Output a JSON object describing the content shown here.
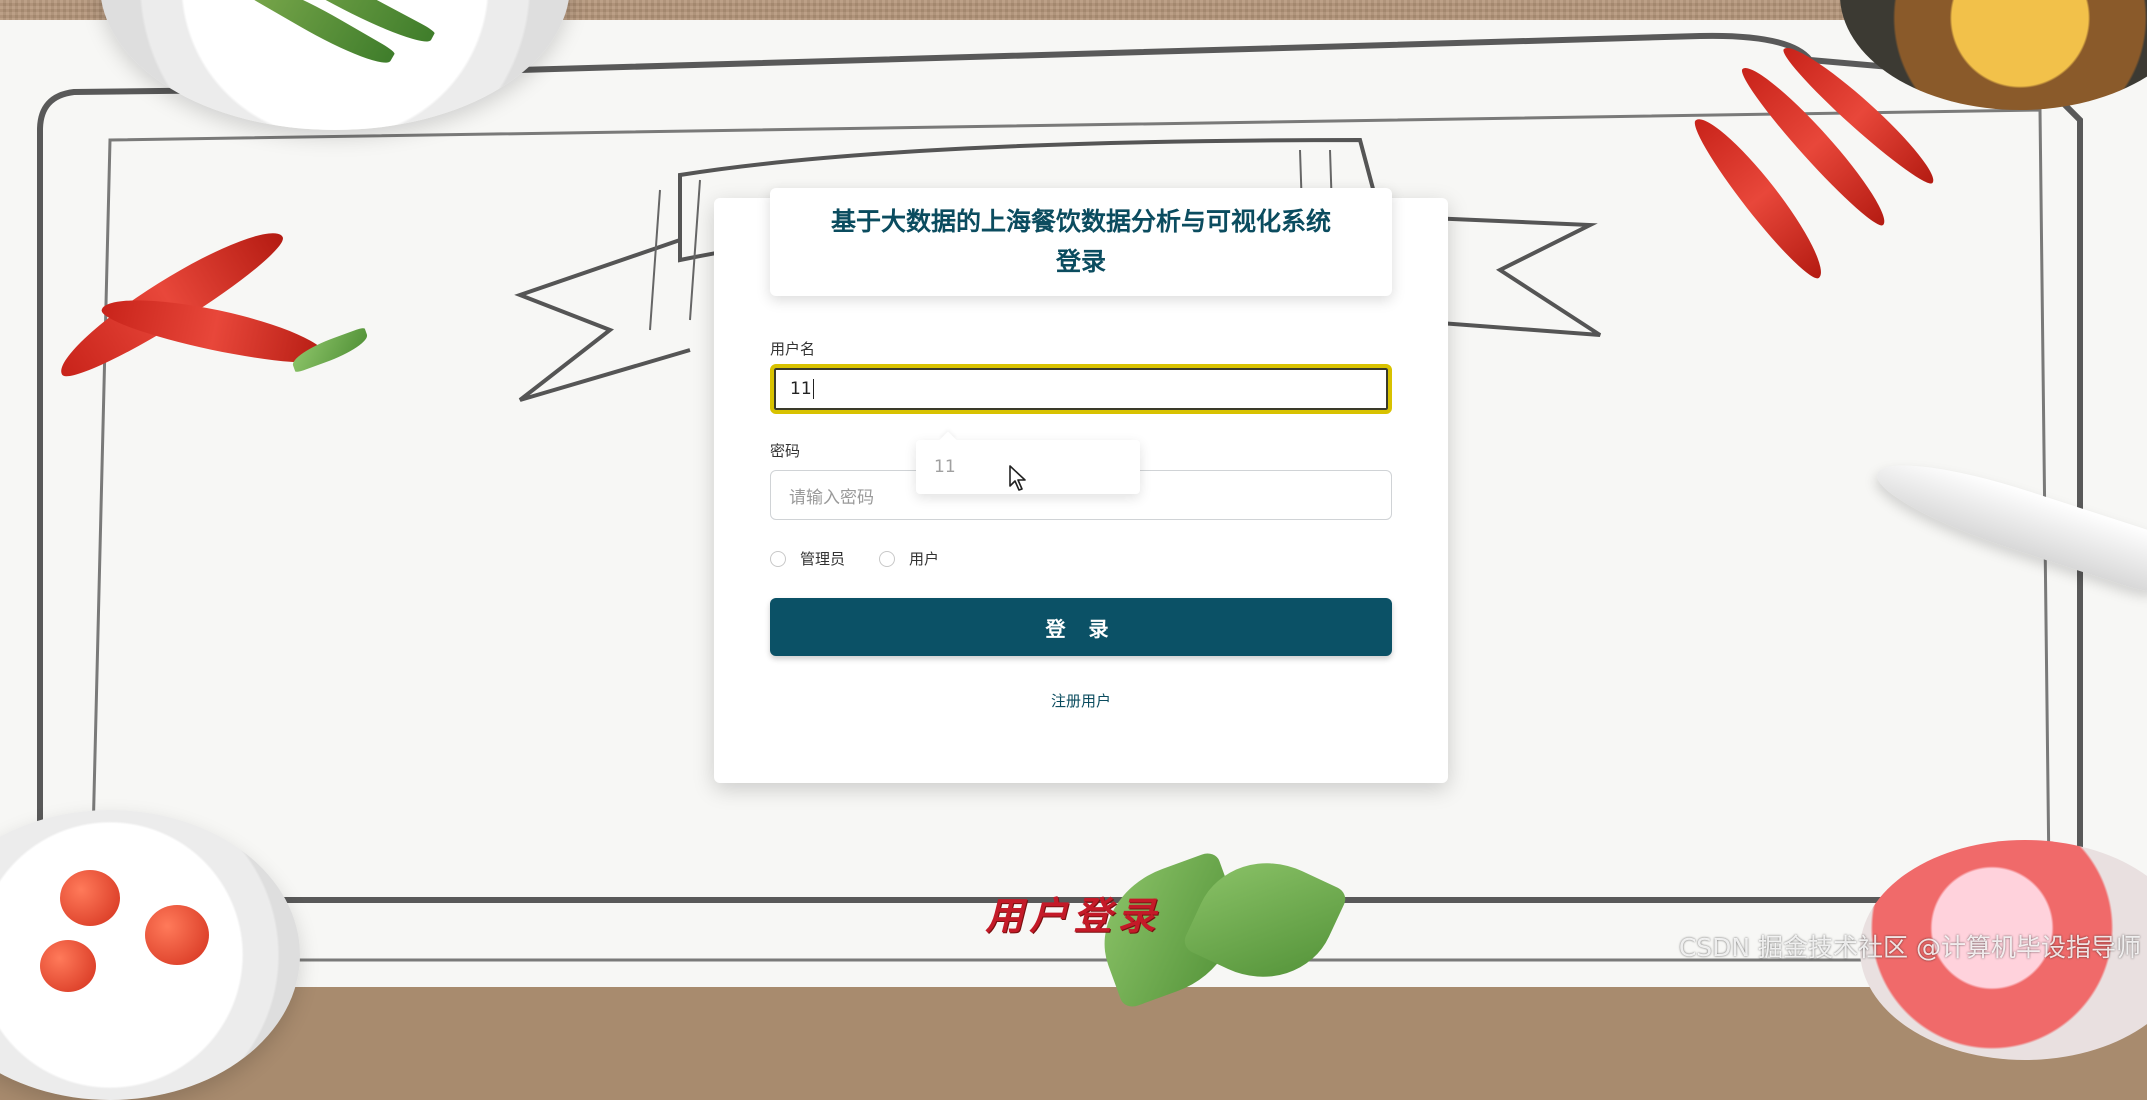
{
  "login": {
    "title_line1": "基于大数据的上海餐饮数据分析与可视化系统",
    "title_line2": "登录",
    "username_label": "用户名",
    "username_value": "11",
    "password_label": "密码",
    "password_placeholder": "请输入密码",
    "roles": [
      "管理员",
      "用户"
    ],
    "login_button": "登 录",
    "register_link": "注册用户"
  },
  "autocomplete": {
    "suggestion": "11"
  },
  "background": {
    "banner_title": "用户登录",
    "watermark": "CSDN 掘金技术社区 @计算机毕设指导师"
  },
  "colors": {
    "primary": "#0b5166",
    "title": "#0b4c5f",
    "focus_border": "#d8c200",
    "banner": "#c41a28"
  },
  "icons": {
    "cursor": "mouse-pointer-icon"
  }
}
